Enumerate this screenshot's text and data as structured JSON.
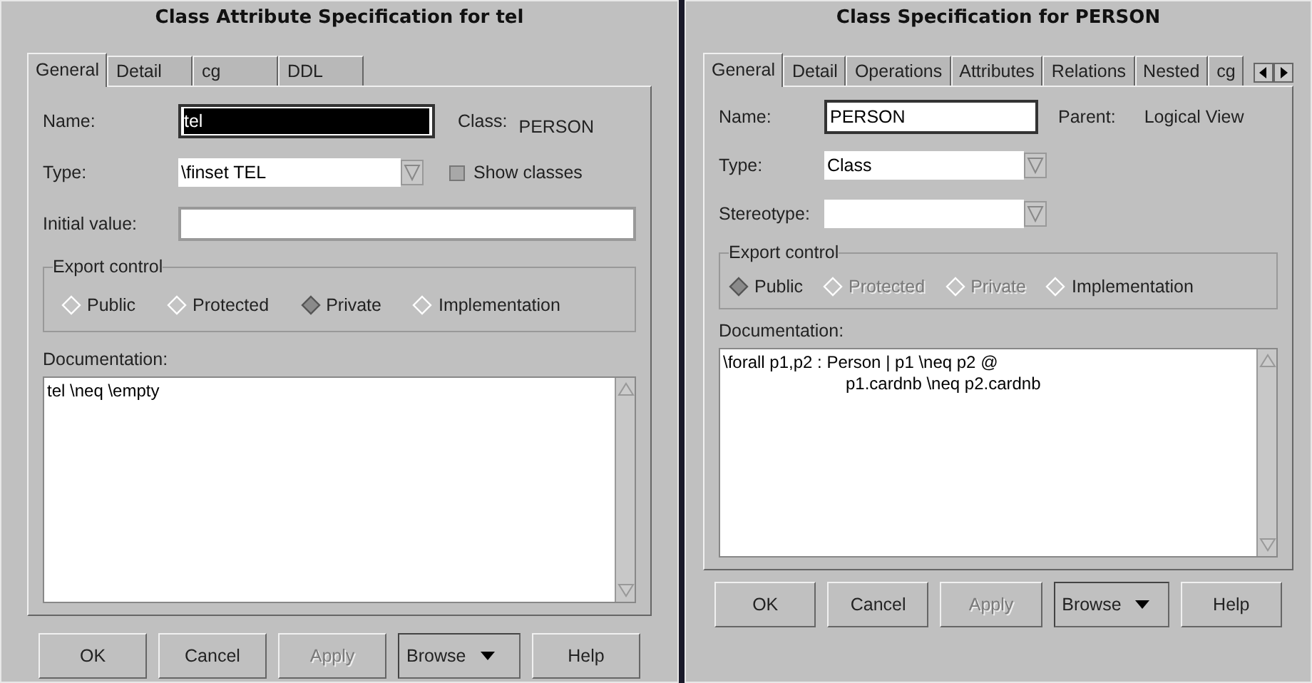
{
  "dialogs": [
    {
      "title": "Class Attribute Specification for tel",
      "tabs": [
        {
          "label": "General",
          "selected": true
        },
        {
          "label": "Detail",
          "selected": false
        },
        {
          "label": "cg",
          "selected": false
        },
        {
          "label": "DDL",
          "selected": false
        }
      ],
      "tab_arrows": false,
      "rows": [
        {
          "label": "Name:",
          "kind": "text",
          "value": "tel",
          "text_selected": true,
          "extra": {
            "kind": "info",
            "label": "Class:",
            "value": "PERSON"
          }
        },
        {
          "label": "Type:",
          "kind": "combo",
          "value": "\\finset TEL",
          "extra": {
            "kind": "checkbox",
            "label": "Show classes",
            "checked": false
          }
        },
        {
          "label": "Initial value:",
          "kind": "text",
          "value": ""
        }
      ],
      "export": {
        "label": "Export control",
        "options": [
          {
            "label": "Public",
            "selected": false,
            "disabled": false
          },
          {
            "label": "Protected",
            "selected": false,
            "disabled": false
          },
          {
            "label": "Private",
            "selected": true,
            "disabled": false
          },
          {
            "label": "Implementation",
            "selected": false,
            "disabled": false
          }
        ]
      },
      "documentation": {
        "label": "Documentation:",
        "lines": [
          "tel \\neq \\empty"
        ]
      },
      "buttons": [
        {
          "label": "OK",
          "disabled": false,
          "kind": "push"
        },
        {
          "label": "Cancel",
          "disabled": false,
          "kind": "push"
        },
        {
          "label": "Apply",
          "disabled": true,
          "kind": "push"
        },
        {
          "label": "Browse",
          "disabled": false,
          "kind": "menu"
        },
        {
          "label": "Help",
          "disabled": false,
          "kind": "push"
        }
      ]
    },
    {
      "title": "Class Specification for PERSON",
      "tabs": [
        {
          "label": "General",
          "selected": true
        },
        {
          "label": "Detail",
          "selected": false
        },
        {
          "label": "Operations",
          "selected": false
        },
        {
          "label": "Attributes",
          "selected": false
        },
        {
          "label": "Relations",
          "selected": false
        },
        {
          "label": "Nested",
          "selected": false
        },
        {
          "label": "cg",
          "selected": false
        }
      ],
      "tab_arrows": true,
      "rows": [
        {
          "label": "Name:",
          "kind": "text",
          "value": "PERSON",
          "text_selected": false,
          "extra": {
            "kind": "info",
            "label": "Parent:",
            "value": "Logical View"
          }
        },
        {
          "label": "Type:",
          "kind": "combo",
          "value": "Class"
        },
        {
          "label": "Stereotype:",
          "kind": "combo",
          "value": ""
        }
      ],
      "export": {
        "label": "Export control",
        "options": [
          {
            "label": "Public",
            "selected": true,
            "disabled": false
          },
          {
            "label": "Protected",
            "selected": false,
            "disabled": true
          },
          {
            "label": "Private",
            "selected": false,
            "disabled": true
          },
          {
            "label": "Implementation",
            "selected": false,
            "disabled": false
          }
        ]
      },
      "documentation": {
        "label": "Documentation:",
        "lines": [
          "\\forall p1,p2 : Person | p1 \\neq p2 @",
          "p1.cardnb \\neq p2.cardnb"
        ]
      },
      "buttons": [
        {
          "label": "OK",
          "disabled": false,
          "kind": "push"
        },
        {
          "label": "Cancel",
          "disabled": false,
          "kind": "push"
        },
        {
          "label": "Apply",
          "disabled": true,
          "kind": "push"
        },
        {
          "label": "Browse",
          "disabled": false,
          "kind": "menu"
        },
        {
          "label": "Help",
          "disabled": false,
          "kind": "push"
        }
      ]
    }
  ]
}
